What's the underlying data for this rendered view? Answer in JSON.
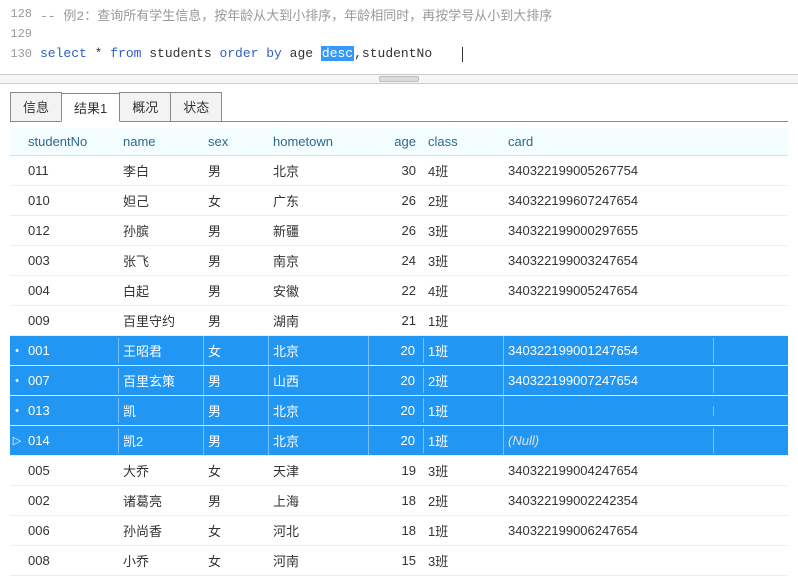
{
  "editor": {
    "lines": [
      {
        "num": "128",
        "type": "comment",
        "text": "-- 例2：查询所有学生信息，按年龄从大到小排序，年龄相同时，再按学号从小到大排序"
      },
      {
        "num": "129",
        "type": "blank",
        "text": ""
      },
      {
        "num": "130",
        "type": "sql"
      }
    ],
    "sql": {
      "p1": "select",
      "p2": " * ",
      "p3": "from",
      "p4": " students ",
      "p5": "order by",
      "p6": " age ",
      "p7": "desc",
      "p8": ",studentNo"
    }
  },
  "tabs": [
    {
      "id": "info",
      "label": "信息",
      "active": false
    },
    {
      "id": "result1",
      "label": "结果1",
      "active": true
    },
    {
      "id": "overview",
      "label": "概况",
      "active": false
    },
    {
      "id": "status",
      "label": "状态",
      "active": false
    }
  ],
  "grid": {
    "headers": {
      "studentNo": "studentNo",
      "name": "name",
      "sex": "sex",
      "hometown": "hometown",
      "age": "age",
      "class": "class",
      "card": "card"
    },
    "rows": [
      {
        "ind": "",
        "studentNo": "011",
        "name": "李白",
        "sex": "男",
        "hometown": "北京",
        "age": "30",
        "class": "4班",
        "card": "340322199005267754",
        "sel": false
      },
      {
        "ind": "",
        "studentNo": "010",
        "name": "妲己",
        "sex": "女",
        "hometown": "广东",
        "age": "26",
        "class": "2班",
        "card": "340322199607247654",
        "sel": false
      },
      {
        "ind": "",
        "studentNo": "012",
        "name": "孙膑",
        "sex": "男",
        "hometown": "新疆",
        "age": "26",
        "class": "3班",
        "card": "340322199000297655",
        "sel": false
      },
      {
        "ind": "",
        "studentNo": "003",
        "name": "张飞",
        "sex": "男",
        "hometown": "南京",
        "age": "24",
        "class": "3班",
        "card": "340322199003247654",
        "sel": false
      },
      {
        "ind": "",
        "studentNo": "004",
        "name": "白起",
        "sex": "男",
        "hometown": "安徽",
        "age": "22",
        "class": "4班",
        "card": "340322199005247654",
        "sel": false
      },
      {
        "ind": "",
        "studentNo": "009",
        "name": "百里守约",
        "sex": "男",
        "hometown": "湖南",
        "age": "21",
        "class": "1班",
        "card": "",
        "sel": false
      },
      {
        "ind": "•",
        "studentNo": "001",
        "name": "王昭君",
        "sex": "女",
        "hometown": "北京",
        "age": "20",
        "class": "1班",
        "card": "340322199001247654",
        "sel": true
      },
      {
        "ind": "•",
        "studentNo": "007",
        "name": "百里玄策",
        "sex": "男",
        "hometown": "山西",
        "age": "20",
        "class": "2班",
        "card": "340322199007247654",
        "sel": true
      },
      {
        "ind": "•",
        "studentNo": "013",
        "name": "凯",
        "sex": "男",
        "hometown": "北京",
        "age": "20",
        "class": "1班",
        "card": "",
        "sel": true
      },
      {
        "ind": "▷",
        "studentNo": "014",
        "name": "凯2",
        "sex": "男",
        "hometown": "北京",
        "age": "20",
        "class": "1班",
        "card": "(Null)",
        "sel": true,
        "null_card": true
      },
      {
        "ind": "",
        "studentNo": "005",
        "name": "大乔",
        "sex": "女",
        "hometown": "天津",
        "age": "19",
        "class": "3班",
        "card": "340322199004247654",
        "sel": false
      },
      {
        "ind": "",
        "studentNo": "002",
        "name": "诸葛亮",
        "sex": "男",
        "hometown": "上海",
        "age": "18",
        "class": "2班",
        "card": "340322199002242354",
        "sel": false
      },
      {
        "ind": "",
        "studentNo": "006",
        "name": "孙尚香",
        "sex": "女",
        "hometown": "河北",
        "age": "18",
        "class": "1班",
        "card": "340322199006247654",
        "sel": false
      },
      {
        "ind": "",
        "studentNo": "008",
        "name": "小乔",
        "sex": "女",
        "hometown": "河南",
        "age": "15",
        "class": "3班",
        "card": "",
        "sel": false
      }
    ]
  }
}
